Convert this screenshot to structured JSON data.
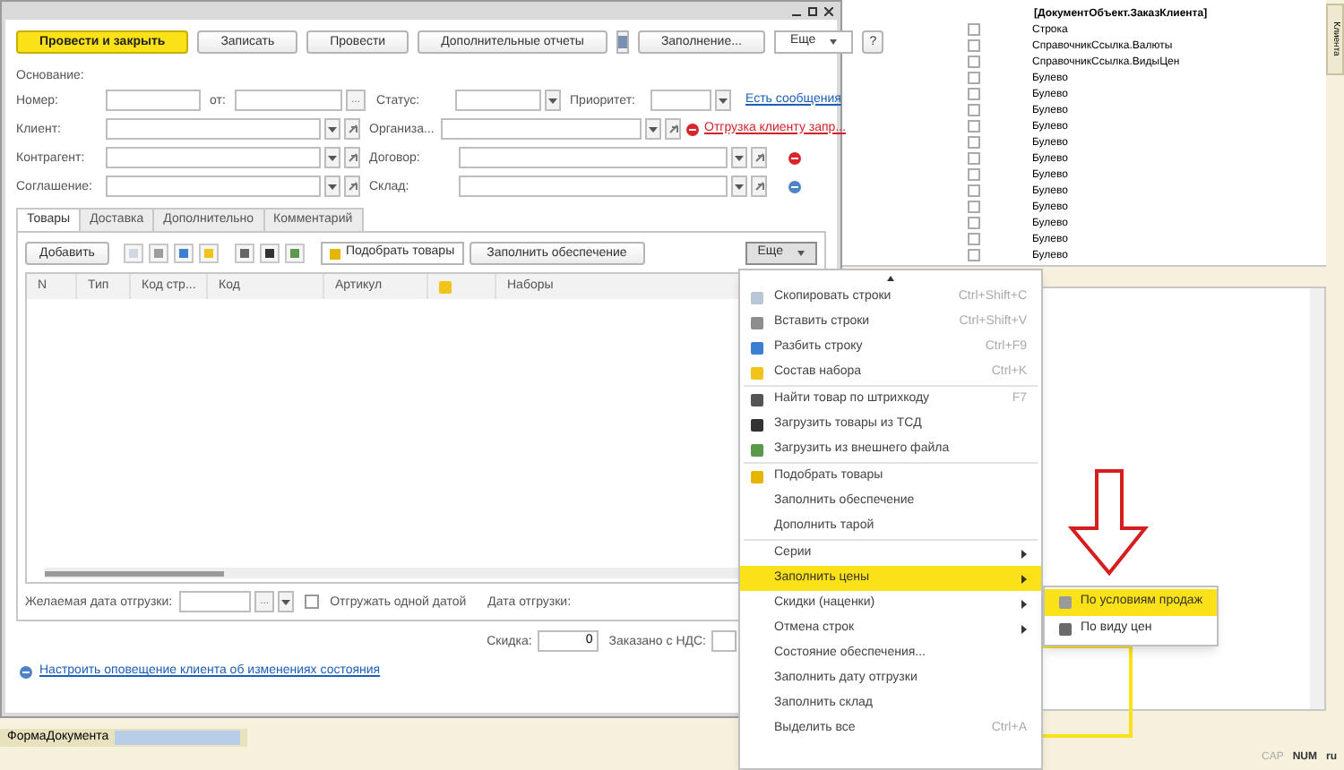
{
  "toolbar": [
    {
      "kind": "primary",
      "label": "Провести и закрыть"
    },
    {
      "kind": "button",
      "label": "Записать"
    },
    {
      "kind": "button",
      "label": "Провести"
    },
    {
      "kind": "button",
      "label": "Дополнительные отчеты"
    },
    {
      "kind": "icon"
    },
    {
      "kind": "button",
      "label": "Заполнение..."
    },
    {
      "kind": "menu",
      "label": "Еще"
    },
    {
      "kind": "button",
      "label": "?"
    }
  ],
  "basis_label": "Основание:",
  "fields": {
    "number": "Номер:",
    "date": "от:",
    "date_button": "...",
    "status": "Статус:",
    "priority": "Приоритет:",
    "messages_link": "Есть сообщения",
    "client": "Клиент:",
    "organization": "Организа...",
    "shipment_warning": "Отгрузка клиенту запр...",
    "counterparty": "Контрагент:",
    "contract": "Договор:",
    "agreement": "Соглашение:",
    "warehouse": "Склад:"
  },
  "tabs": [
    {
      "label": "Товары",
      "selected": true
    },
    {
      "label": "Доставка",
      "selected": false
    },
    {
      "label": "Дополнительно",
      "selected": false
    },
    {
      "label": "Комментарий",
      "selected": false
    }
  ],
  "table_toolbar": {
    "add": "Добавить",
    "pick": "Подобрать товары",
    "fill": "Заполнить обеспечение",
    "more": "Еще"
  },
  "columns": [
    {
      "kind": "text",
      "label": "N"
    },
    {
      "kind": "text",
      "label": "Тип"
    },
    {
      "kind": "text",
      "label": "Код стр..."
    },
    {
      "kind": "text",
      "label": "Код"
    },
    {
      "kind": "text",
      "label": "Артикул"
    },
    {
      "kind": "icon"
    },
    {
      "kind": "text",
      "label": "Наборы"
    }
  ],
  "footer": {
    "desired_date": "Желаемая дата отгрузки:",
    "date_button": "...",
    "one_date": {
      "label": "Отгружать одной датой",
      "checked": false
    },
    "ship_date": "Дата отгрузки:"
  },
  "totals": {
    "discount_label": "Скидка:",
    "discount_value": "0",
    "ordered_label": "Заказано с НДС:"
  },
  "notify_link": "Настроить оповещение клиента об изменениях состояния",
  "menu": [
    {
      "kind": "item",
      "label": "Скопировать строки",
      "shortcut": "Ctrl+Shift+C",
      "selected": false
    },
    {
      "kind": "item",
      "label": "Вставить строки",
      "shortcut": "Ctrl+Shift+V",
      "selected": false
    },
    {
      "kind": "item",
      "label": "Разбить строку",
      "shortcut": "Ctrl+F9",
      "selected": false
    },
    {
      "kind": "item",
      "label": "Состав набора",
      "shortcut": "Ctrl+K",
      "selected": false
    },
    {
      "kind": "separator"
    },
    {
      "kind": "item",
      "label": "Найти товар по штрихкоду",
      "shortcut": "F7",
      "selected": false
    },
    {
      "kind": "item",
      "label": "Загрузить товары из ТСД",
      "selected": false
    },
    {
      "kind": "item",
      "label": "Загрузить из внешнего файла",
      "selected": false
    },
    {
      "kind": "separator"
    },
    {
      "kind": "item",
      "label": "Подобрать товары",
      "selected": false
    },
    {
      "kind": "item",
      "label": "Заполнить обеспечение",
      "selected": false
    },
    {
      "kind": "item",
      "label": "Дополнить тарой",
      "selected": false
    },
    {
      "kind": "separator"
    },
    {
      "kind": "submenu",
      "label": "Серии",
      "selected": false
    },
    {
      "kind": "submenu",
      "label": "Заполнить цены",
      "selected": true
    },
    {
      "kind": "submenu",
      "label": "Скидки (наценки)",
      "selected": false
    },
    {
      "kind": "submenu",
      "label": "Отмена строк",
      "selected": false
    },
    {
      "kind": "item",
      "label": "Состояние обеспечения...",
      "selected": false
    },
    {
      "kind": "item",
      "label": "Заполнить дату отгрузки",
      "selected": false
    },
    {
      "kind": "item",
      "label": "Заполнить склад",
      "selected": false
    },
    {
      "kind": "item",
      "label": "Выделить все",
      "shortcut": "Ctrl+A",
      "selected": false
    }
  ],
  "submenu": [
    {
      "label": "По условиям продаж",
      "selected": true
    },
    {
      "label": "По виду цен",
      "selected": false
    }
  ],
  "side_list": {
    "header": "[ДокументОбъект.ЗаказКлиента]",
    "rows": [
      {
        "label": "Строка",
        "checked": false
      },
      {
        "label": "СправочникСсылка.Валюты",
        "checked": false
      },
      {
        "label": "СправочникСсылка.ВидыЦен",
        "checked": false
      },
      {
        "label": "Булево",
        "checked": false
      },
      {
        "label": "Булево",
        "checked": false
      },
      {
        "label": "Булево",
        "checked": false
      },
      {
        "label": "Булево",
        "checked": false
      },
      {
        "label": "Булево",
        "checked": false
      },
      {
        "label": "Булево",
        "checked": false
      },
      {
        "label": "Булево",
        "checked": false
      },
      {
        "label": "Булево",
        "checked": false
      },
      {
        "label": "Булево",
        "checked": false
      },
      {
        "label": "Булево",
        "checked": false
      },
      {
        "label": "Булево",
        "checked": false
      },
      {
        "label": "Булево",
        "checked": false
      }
    ]
  },
  "side_tab": "Клиента",
  "taskbar": [
    {
      "label": "ФормаДокумента",
      "selected": true
    }
  ],
  "status_bar": [
    {
      "label": "CAP",
      "on": false
    },
    {
      "label": "NUM",
      "on": true
    },
    {
      "label": "ru",
      "on": true
    }
  ]
}
